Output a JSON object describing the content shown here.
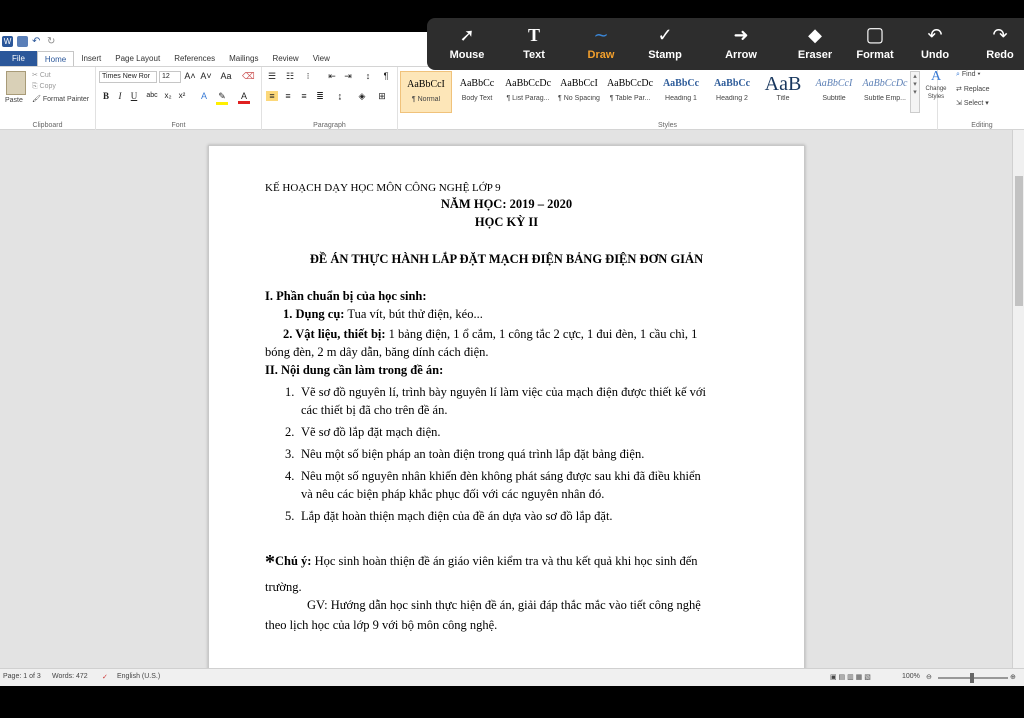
{
  "qat": {
    "save_label": "W"
  },
  "tabs": [
    "File",
    "Home",
    "Insert",
    "Page Layout",
    "References",
    "Mailings",
    "Review",
    "View"
  ],
  "ribbon": {
    "clipboard": {
      "paste": "Paste",
      "cut": "Cut",
      "copy": "Copy",
      "format_painter": "Format Painter",
      "label": "Clipboard"
    },
    "font": {
      "name": "Times New Ror",
      "size": "12",
      "label": "Font"
    },
    "paragraph": {
      "label": "Paragraph"
    },
    "styles": {
      "label": "Styles",
      "items": [
        {
          "preview": "AaBbCcI",
          "name": "¶ Normal"
        },
        {
          "preview": "AaBbCc",
          "name": "Body Text"
        },
        {
          "preview": "AaBbCcDc",
          "name": "¶ List Parag..."
        },
        {
          "preview": "AaBbCcI",
          "name": "¶ No Spacing"
        },
        {
          "preview": "AaBbCcDc",
          "name": "¶ Table Par..."
        },
        {
          "preview": "AaBbCc",
          "name": "Heading 1"
        },
        {
          "preview": "AaBbCc",
          "name": "Heading 2"
        },
        {
          "preview": "AaB",
          "name": "Title"
        },
        {
          "preview": "AaBbCcI",
          "name": "Subtitle"
        },
        {
          "preview": "AaBbCcDc",
          "name": "Subtle Emp..."
        }
      ],
      "change_styles": "Change Styles"
    },
    "editing": {
      "find": "Find",
      "replace": "Replace",
      "select": "Select",
      "label": "Editing"
    }
  },
  "document": {
    "header_line": "KẾ HOẠCH DẠY HỌC MÔN CÔNG NGHỆ LỚP 9",
    "year": "NĂM HỌC: 2019 – 2020",
    "semester": "HỌC KỲ II",
    "title": "ĐỀ ÁN THỰC HÀNH LẮP ĐẶT MẠCH ĐIỆN BẢNG ĐIỆN ĐƠN GIẢN",
    "section1": "I. Phần chuẩn bị của học sinh:",
    "tools_label": "1. Dụng cụ:",
    "tools_text": " Tua vít, bút thử điện, kéo...",
    "materials_label": "2. Vật liệu, thiết bị:",
    "materials_text": " 1 bảng điện, 1 ổ cắm, 1 công tắc 2 cực, 1 đui đèn, 1 cầu chì, 1",
    "materials_text2": "bóng đèn, 2 m dây dẫn, băng dính cách điện.",
    "section2": "II.  Nội dung cần làm trong đề án:",
    "items": [
      {
        "num": "1.",
        "l1": "Vẽ sơ đồ nguyên lí, trình bày nguyên lí làm việc của mạch điện được thiết kế với",
        "l2": "các thiết bị đã cho trên đề án."
      },
      {
        "num": "2.",
        "l1": "Vẽ sơ đồ lắp đặt mạch điện.",
        "l2": ""
      },
      {
        "num": "3.",
        "l1": "Nêu một số biện pháp an toàn điện trong quá trình lắp đặt bảng điện.",
        "l2": ""
      },
      {
        "num": "4.",
        "l1": "Nêu một số nguyên nhân khiến đèn không phát sáng được sau khi đã điều khiển",
        "l2": "và nêu các biện pháp khắc phục đối với các nguyên nhân đó."
      },
      {
        "num": "5.",
        "l1": "Lắp đặt hoàn thiện mạch điện của đề án dựa vào sơ đồ lắp đặt.",
        "l2": ""
      }
    ],
    "note_star": "*",
    "note_label": "Chú ý:",
    "note_text": " Học sinh hoàn thiện đề án giáo viên kiểm tra và thu kết quả khi học sinh đến",
    "note_text2": "trường.",
    "gv_line1": "GV: Hướng dẫn học sinh thực hiện đề án, giải đáp thắc mắc vào tiết công nghệ",
    "gv_line2": "theo lịch học của lớp 9 với bộ môn công nghệ."
  },
  "status": {
    "page": "Page: 1 of 3",
    "words": "Words: 472",
    "language": "English (U.S.)",
    "zoom": "100%"
  },
  "annotation_toolbar": {
    "tools": [
      {
        "label": "Mouse",
        "icon": "cursor-icon",
        "glyph": "➚"
      },
      {
        "label": "Text",
        "icon": "text-icon",
        "glyph": "T"
      },
      {
        "label": "Draw",
        "icon": "draw-icon",
        "glyph": "∼"
      },
      {
        "label": "Stamp",
        "icon": "stamp-icon",
        "glyph": "✓"
      },
      {
        "label": "Arrow",
        "icon": "arrow-icon",
        "glyph": "➜"
      },
      {
        "label": "Eraser",
        "icon": "eraser-icon",
        "glyph": "◆"
      },
      {
        "label": "Format",
        "icon": "format-icon",
        "glyph": "▢"
      },
      {
        "label": "Undo",
        "icon": "undo-icon",
        "glyph": "↶"
      },
      {
        "label": "Redo",
        "icon": "redo-icon",
        "glyph": "↷"
      }
    ],
    "active": "Draw",
    "active_color": "#f3a02c"
  }
}
